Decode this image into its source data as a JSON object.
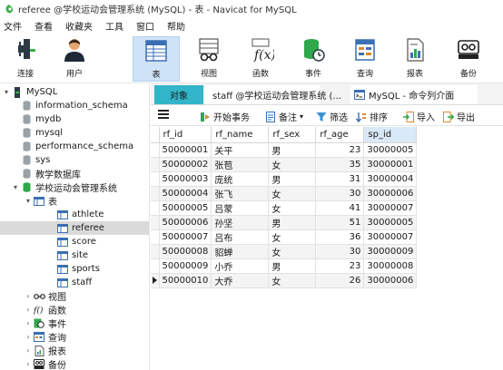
{
  "window": {
    "title": "referee @学校运动会管理系统 (MySQL) - 表 - Navicat for MySQL"
  },
  "menu": [
    "文件",
    "查看",
    "收藏夹",
    "工具",
    "窗口",
    "帮助"
  ],
  "toolbar": [
    {
      "label": "连接",
      "icon": "connect-icon"
    },
    {
      "label": "用户",
      "icon": "user-icon"
    },
    {
      "label": "表",
      "icon": "table-icon"
    },
    {
      "label": "视图",
      "icon": "view-icon"
    },
    {
      "label": "函数",
      "icon": "function-icon"
    },
    {
      "label": "事件",
      "icon": "event-icon"
    },
    {
      "label": "查询",
      "icon": "query-icon"
    },
    {
      "label": "报表",
      "icon": "report-icon"
    },
    {
      "label": "备份",
      "icon": "backup-icon"
    }
  ],
  "sidebar": {
    "connection": "MySQL",
    "databases": [
      "information_schema",
      "mydb",
      "mysql",
      "performance_schema",
      "sys",
      "教学数据库",
      "学校运动会管理系统"
    ],
    "tables_group": "表",
    "tables": [
      "athlete",
      "referee",
      "score",
      "site",
      "sports",
      "staff"
    ],
    "other_groups": [
      "视图",
      "函数",
      "事件",
      "查询",
      "报表",
      "备份"
    ]
  },
  "tabs": {
    "objects": "对象",
    "staff": "staff @学校运动会管理系统 (...",
    "console": "MySQL - 命令列介面"
  },
  "actions": {
    "begin_transaction": "开始事务",
    "memo": "备注",
    "filter": "筛选",
    "sort": "排序",
    "import": "导入",
    "export": "导出"
  },
  "grid": {
    "columns": [
      "rf_id",
      "rf_name",
      "rf_sex",
      "rf_age",
      "sp_id"
    ],
    "rows": [
      [
        "50000001",
        "关平",
        "男",
        "23",
        "30000005"
      ],
      [
        "50000002",
        "张苞",
        "女",
        "35",
        "30000001"
      ],
      [
        "50000003",
        "庞统",
        "男",
        "31",
        "30000004"
      ],
      [
        "50000004",
        "张飞",
        "女",
        "30",
        "30000006"
      ],
      [
        "50000005",
        "吕蒙",
        "女",
        "41",
        "30000007"
      ],
      [
        "50000006",
        "孙坚",
        "男",
        "51",
        "30000005"
      ],
      [
        "50000007",
        "吕布",
        "女",
        "36",
        "30000007"
      ],
      [
        "50000008",
        "貂蝉",
        "女",
        "30",
        "30000009"
      ],
      [
        "50000009",
        "小乔",
        "男",
        "23",
        "30000008"
      ],
      [
        "50000010",
        "大乔",
        "女",
        "26",
        "30000006"
      ]
    ]
  },
  "colors": {
    "accent": "#32b5c9",
    "selected_tool": "#cfe3f6",
    "header_highlight": "#d9e9f7"
  }
}
